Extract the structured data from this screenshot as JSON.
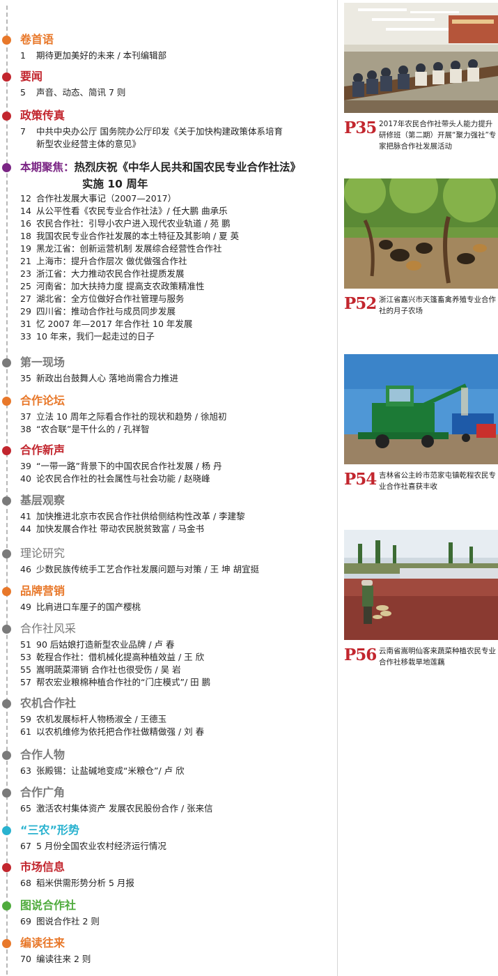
{
  "sections": [
    {
      "id": "s1",
      "title": "卷首语",
      "color": "#e8782a",
      "items": [
        {
          "num": "1",
          "text": "期待更加美好的未来 / 本刊编辑部"
        }
      ]
    },
    {
      "id": "s2",
      "title": "要闻",
      "color": "#c2262e",
      "items": [
        {
          "num": "5",
          "text": "声音、动态、简讯 7 则"
        }
      ]
    },
    {
      "id": "s3",
      "title": "政策传真",
      "color": "#c2262e",
      "items": [
        {
          "num": "7",
          "text": "中共中央办公厅  国务院办公厅印发《关于加快构建政策体系培育",
          "cont": "新型农业经营主体的意见》"
        }
      ]
    },
    {
      "id": "s4",
      "label": "本期聚焦：",
      "title": "热烈庆祝《中华人民共和国农民专业合作社法》",
      "subtitle": "实施 10 周年",
      "color": "#7a2584",
      "items": [
        {
          "num": "12",
          "text": "合作社发展大事记（2007—2017）"
        },
        {
          "num": "14",
          "text": "从公平性看《农民专业合作社法》/ 任大鹏   曲承乐"
        },
        {
          "num": "16",
          "text": "农民合作社：引导小农户进入现代农业轨道 / 苑  鹏"
        },
        {
          "num": "18",
          "text": "我国农民专业合作社发展的本土特征及其影响 / 夏  英"
        },
        {
          "num": "19",
          "text": "黑龙江省：创新运营机制  发展综合经营性合作社"
        },
        {
          "num": "21",
          "text": "上海市：提升合作层次  做优做强合作社"
        },
        {
          "num": "23",
          "text": "浙江省：大力推动农民合作社提质发展"
        },
        {
          "num": "25",
          "text": "河南省：加大扶持力度  提高支农政策精准性"
        },
        {
          "num": "27",
          "text": "湖北省：全方位做好合作社管理与服务"
        },
        {
          "num": "29",
          "text": "四川省：推动合作社与成员同步发展"
        },
        {
          "num": "31",
          "text": "忆 2007 年—2017 年合作社 10 年发展"
        },
        {
          "num": "33",
          "text": "10 年来，我们一起走过的日子"
        }
      ]
    },
    {
      "id": "s5",
      "title": "第一现场",
      "color": "#7a7a7a",
      "items": [
        {
          "num": "35",
          "text": "新政出台鼓舞人心  落地尚需合力推进"
        }
      ]
    },
    {
      "id": "s6",
      "title": "合作论坛",
      "color": "#e8782a",
      "items": [
        {
          "num": "37",
          "text": "立法 10 周年之际看合作社的现状和趋势 / 徐旭初"
        },
        {
          "num": "38",
          "text": "“农合联”是干什么的 / 孔祥智"
        }
      ]
    },
    {
      "id": "s7",
      "title": "合作新声",
      "color": "#c2262e",
      "items": [
        {
          "num": "39",
          "text": "“一带一路”背景下的中国农民合作社发展 / 杨  丹"
        },
        {
          "num": "40",
          "text": "论农民合作社的社会属性与社会功能 / 赵晓峰"
        }
      ]
    },
    {
      "id": "s8",
      "title": "基层观察",
      "color": "#7a7a7a",
      "items": [
        {
          "num": "41",
          "text": "加快推进北京市农民合作社供给侧结构性改革 / 李建黎"
        },
        {
          "num": "44",
          "text": "加快发展合作社  带动农民脱贫致富 / 马金书"
        }
      ]
    },
    {
      "id": "s9",
      "title": "理论研究",
      "color": "#7a7a7a",
      "items": [
        {
          "num": "46",
          "text": "少数民族传统手工艺合作社发展问题与对策 / 王  坤   胡宜挺"
        }
      ]
    },
    {
      "id": "s10",
      "title": "品牌营销",
      "color": "#e8782a",
      "items": [
        {
          "num": "49",
          "text": "比肩进口车厘子的国产樱桃"
        }
      ]
    },
    {
      "id": "s11",
      "title": "合作社风采",
      "color": "#7a7a7a",
      "items": [
        {
          "num": "51",
          "text": "90 后姑娘打造新型农业品牌 / 卢  春"
        },
        {
          "num": "53",
          "text": "乾程合作社：借机械化提高种植效益 / 王  欣"
        },
        {
          "num": "55",
          "text": "嵩明蔬菜滞销  合作社也很受伤 / 吴  岩"
        },
        {
          "num": "57",
          "text": "帮农宏业粮棉种植合作社的“门庄模式”/ 田  鹏"
        }
      ]
    },
    {
      "id": "s12",
      "title": "农机合作社",
      "color": "#7a7a7a",
      "items": [
        {
          "num": "59",
          "text": "农机发展标杆人物杨淑全 / 王德玉"
        },
        {
          "num": "61",
          "text": "以农机维修为依托把合作社做精做强 / 刘  春"
        }
      ]
    },
    {
      "id": "s13",
      "title": "合作人物",
      "color": "#7a7a7a",
      "items": [
        {
          "num": "63",
          "text": "张殿锡：让盐碱地变成“米粮仓”/ 卢  欣"
        }
      ]
    },
    {
      "id": "s14",
      "title": "合作广角",
      "color": "#7a7a7a",
      "items": [
        {
          "num": "65",
          "text": "激活农村集体资产  发展农民股份合作 / 张来信"
        }
      ]
    },
    {
      "id": "s15",
      "title": "“三农”形势",
      "color": "#29b2cf",
      "items": [
        {
          "num": "67",
          "text": "5 月份全国农业农村经济运行情况"
        }
      ]
    },
    {
      "id": "s16",
      "title": "市场信息",
      "color": "#c2262e",
      "items": [
        {
          "num": "68",
          "text": "稻米供需形势分析 5 月报"
        }
      ]
    },
    {
      "id": "s17",
      "title": "图说合作社",
      "color": "#4fab3d",
      "items": [
        {
          "num": "69",
          "text": "图说合作社 2 则"
        }
      ]
    },
    {
      "id": "s18",
      "title": "编读往来",
      "color": "#e8782a",
      "items": [
        {
          "num": "70",
          "text": "编读往来 2 则"
        }
      ]
    }
  ],
  "photos": [
    {
      "page": "P35",
      "caption": "2017年农民合作社带头人能力提升研修班（第二期）开展“聚力强社”专家把脉合作社发展活动",
      "scene": "meeting-room"
    },
    {
      "page": "P52",
      "caption": "浙江省嘉兴市天篷畜禽养殖专业合作社的月子农场",
      "scene": "chicken-orchard"
    },
    {
      "page": "P54",
      "caption": "吉林省公主岭市范家屯镇乾程农民专业合作社喜获丰收",
      "scene": "combine-harvester"
    },
    {
      "page": "P56",
      "caption": "云南省嵩明仙客来蔬菜种植农民专业合作社移栽旱地莲藕",
      "scene": "lotus-field"
    }
  ],
  "colors": {
    "accent_red": "#c2262e",
    "accent_orange": "#e8782a",
    "accent_purple": "#7a2584",
    "accent_teal": "#29b2cf",
    "accent_green": "#4fab3d",
    "accent_gray": "#7a7a7a"
  }
}
